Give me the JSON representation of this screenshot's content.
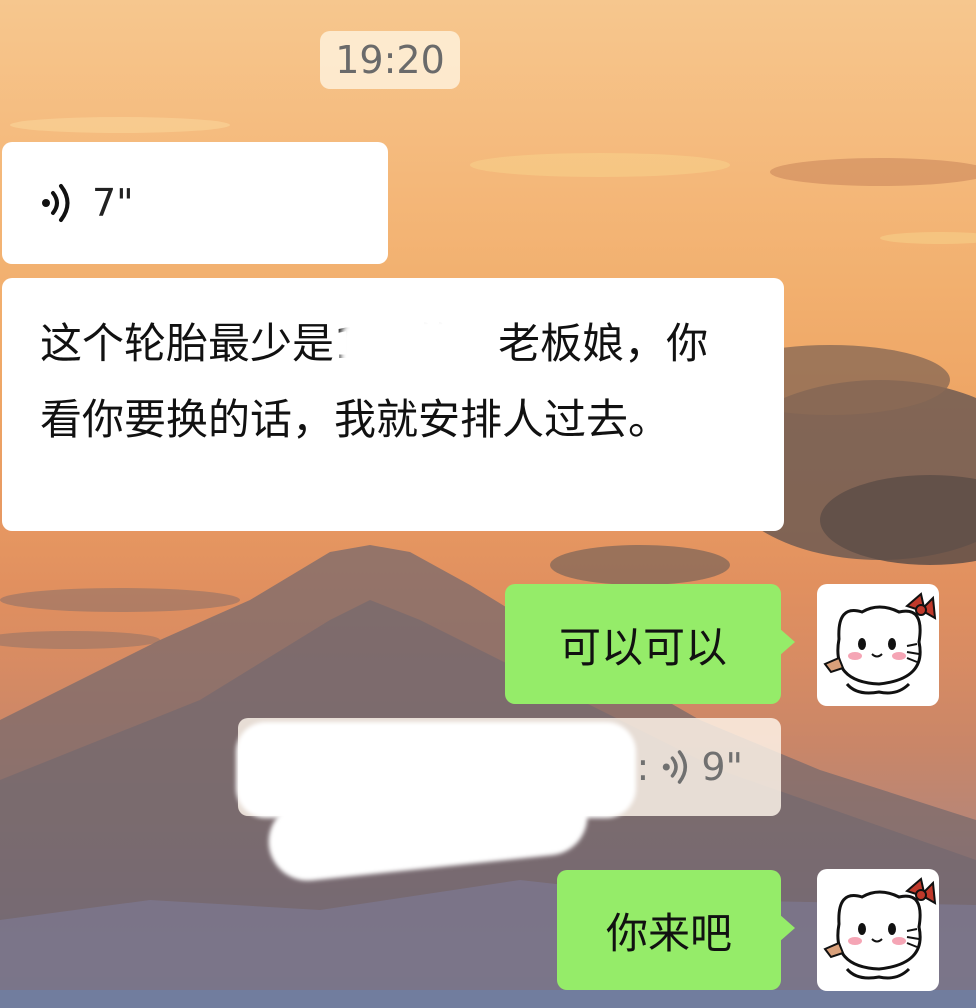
{
  "chat": {
    "timestamp": "19:20",
    "messages": [
      {
        "type": "voice",
        "side": "incoming",
        "duration": "7\""
      },
      {
        "type": "text",
        "side": "incoming",
        "text": "这个轮胎最少是150的，老板娘，你看你要换的话，我就安排人过去。"
      },
      {
        "type": "text",
        "side": "outgoing",
        "text": "可以可以"
      },
      {
        "type": "quote",
        "side": "outgoing",
        "sender_redacted": true,
        "separator": ":",
        "quoted_voice_duration": "9\""
      },
      {
        "type": "text",
        "side": "outgoing",
        "text": "你来吧"
      }
    ]
  },
  "icons": {
    "voice": "voice-wave-icon",
    "avatar": "cat-with-bow-avatar"
  },
  "colors": {
    "incoming_bubble": "#ffffff",
    "outgoing_bubble": "#95ec69",
    "timestamp_text": "#6a6a6a"
  }
}
